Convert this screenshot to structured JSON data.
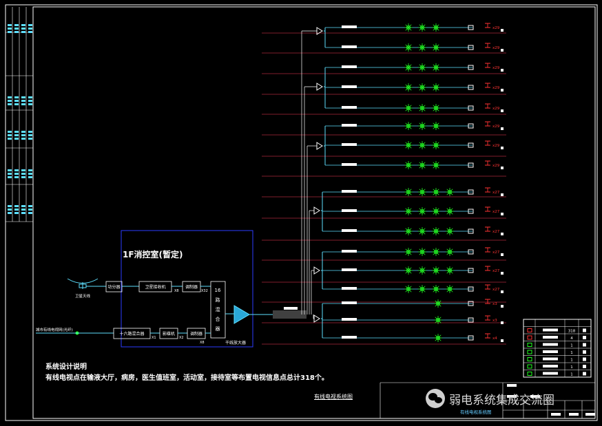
{
  "room_title": "1F消控室(暂定)",
  "notes": {
    "title": "系统设计说明",
    "body": "有线电视点在输液大厅，病房，医生值班室，活动室，接待室等布置电视信息点总计318个。"
  },
  "drawing_title": "有线电视系统图",
  "subtitle": "有线电视系统图",
  "watermark": "弱电系统集成交流圈",
  "labels": {
    "satellite": "卫星天线",
    "city_cable": "城市有线电视网(光纤)",
    "splitter1": "功分器",
    "receiver": "卫星接收机",
    "modulator": "调制器",
    "mixer": "十六路混合器",
    "dvd": "影碟机",
    "demodulator": "调制器",
    "headend_mixer": "16路混合器",
    "trunk_amp": "干线放大器"
  },
  "multipliers": {
    "receiver": "X8",
    "modulator": "X32",
    "mixer": "X1",
    "dvd": "X2",
    "demod": "X8"
  },
  "floors": [
    {
      "count": "x29"
    },
    {
      "count": "x29"
    },
    {
      "count": "x29"
    },
    {
      "count": "x29"
    },
    {
      "count": "x29"
    },
    {
      "count": "x29"
    },
    {
      "count": "x29"
    },
    {
      "count": "x29"
    },
    {
      "count": "x27"
    },
    {
      "count": "x27"
    },
    {
      "count": "x27"
    },
    {
      "count": "x27"
    },
    {
      "count": "x27"
    },
    {
      "count": "x27"
    },
    {
      "count": "x3"
    },
    {
      "count": "x3"
    },
    {
      "count": "x4"
    }
  ],
  "legend_qty": [
    "",
    "318",
    "4",
    "1",
    "1",
    "1",
    "1",
    "1"
  ],
  "colors": {
    "wire": "#5ee0ff",
    "riser": "#ff3d5a",
    "frame": "#ffffff",
    "room": "#2b3cff",
    "outlet": "#ff3333"
  }
}
